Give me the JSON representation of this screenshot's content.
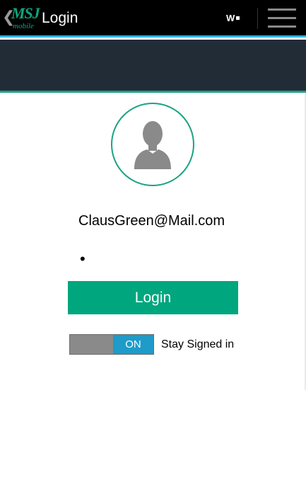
{
  "action_bar": {
    "back_icon": "chevron-left-icon",
    "logo_text": "MSJ",
    "logo_subtext": "mobile",
    "title": "Login",
    "indicator_text": "W",
    "menu_icon": "hamburger-menu-icon"
  },
  "login": {
    "avatar_icon": "user-silhouette-icon",
    "email_value": "ClausGreen@Mail.com",
    "password_value": "•",
    "login_button_label": "Login",
    "stay_signed_in_toggle": "ON",
    "stay_signed_in_label": "Stay Signed in"
  },
  "colors": {
    "action_bar_bg": "#000000",
    "action_bar_accent": "#33b5e5",
    "header_band_bg": "#222c37",
    "brand_green": "#00a67e",
    "toggle_on": "#1e9bc9",
    "toggle_off": "#8a8a8a"
  }
}
